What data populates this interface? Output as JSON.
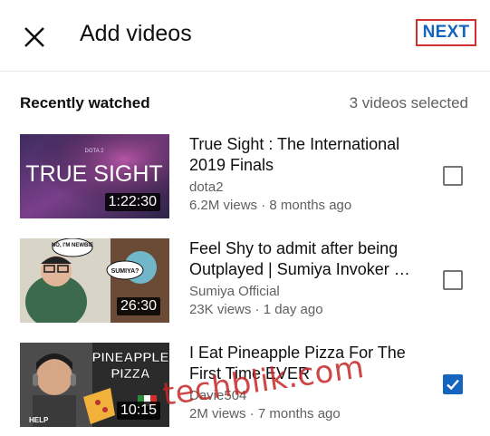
{
  "header": {
    "title": "Add videos",
    "next_label": "NEXT"
  },
  "section": {
    "title": "Recently watched",
    "selected_count": "3 videos selected"
  },
  "videos": [
    {
      "title": "True Sight : The International 2019 Finals",
      "channel": "dota2",
      "meta": "6.2M views · 8 months ago",
      "duration": "1:22:30",
      "thumb_text": "TRUE SIGHT",
      "thumb_badge": "DOTA 2",
      "checked": false
    },
    {
      "title": "Feel Shy to admit after being Outplayed | Sumiya Invoker …",
      "channel": "Sumiya Official",
      "meta": "23K views · 1 day ago",
      "duration": "26:30",
      "thumb_bubble_1": "NO, I'M NEWBIE",
      "thumb_bubble_2": "SUMIYA?",
      "checked": false
    },
    {
      "title": "I Eat Pineapple Pizza For The First Time EVER",
      "channel": "Davie504",
      "meta": "2M views · 7 months ago",
      "duration": "10:15",
      "thumb_text_1": "PINEAPPLE",
      "thumb_text_2": "PIZZA",
      "thumb_help": "HELP",
      "checked": true
    }
  ],
  "watermark": "techblik.com",
  "colors": {
    "accent": "#1565c0",
    "highlight_border": "#d32f2f",
    "secondary_text": "#606060"
  }
}
